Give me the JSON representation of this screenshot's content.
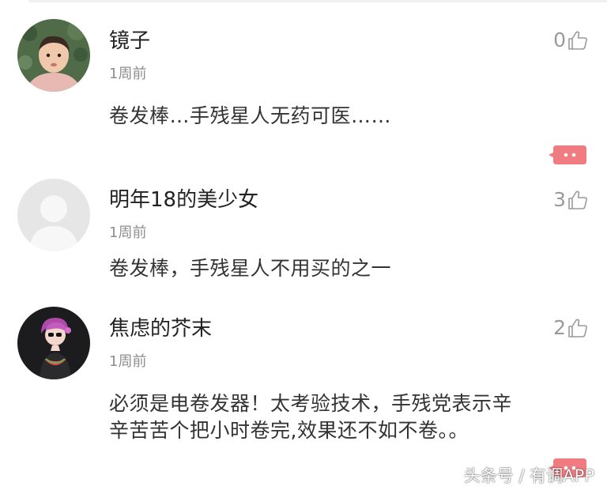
{
  "colors": {
    "accent": "#f07b80",
    "username": "#222222",
    "meta": "#8e8e8e",
    "text": "#333333"
  },
  "comments": [
    {
      "username": "镜子",
      "time": "1周前",
      "likes": "0",
      "content": "卷发棒…手残星人无药可医……",
      "avatar": "child-photo-avatar"
    },
    {
      "username": "明年18的美少女",
      "time": "1周前",
      "likes": "3",
      "content": "卷发棒，手残星人不用买的之一",
      "avatar": "default-gray-avatar"
    },
    {
      "username": "焦虑的芥末",
      "time": "1周前",
      "likes": "2",
      "content_line1": "必须是电卷发器！太考验技术，手残党表示辛",
      "content_line2": "辛苦苦个把小时卷完,效果还不如不卷。。",
      "avatar": "illustrated-girl-avatar"
    }
  ],
  "icons": {
    "like": "thumbs-up-icon",
    "more": "more-options-icon"
  },
  "watermark": "头条号 / 有调APP"
}
